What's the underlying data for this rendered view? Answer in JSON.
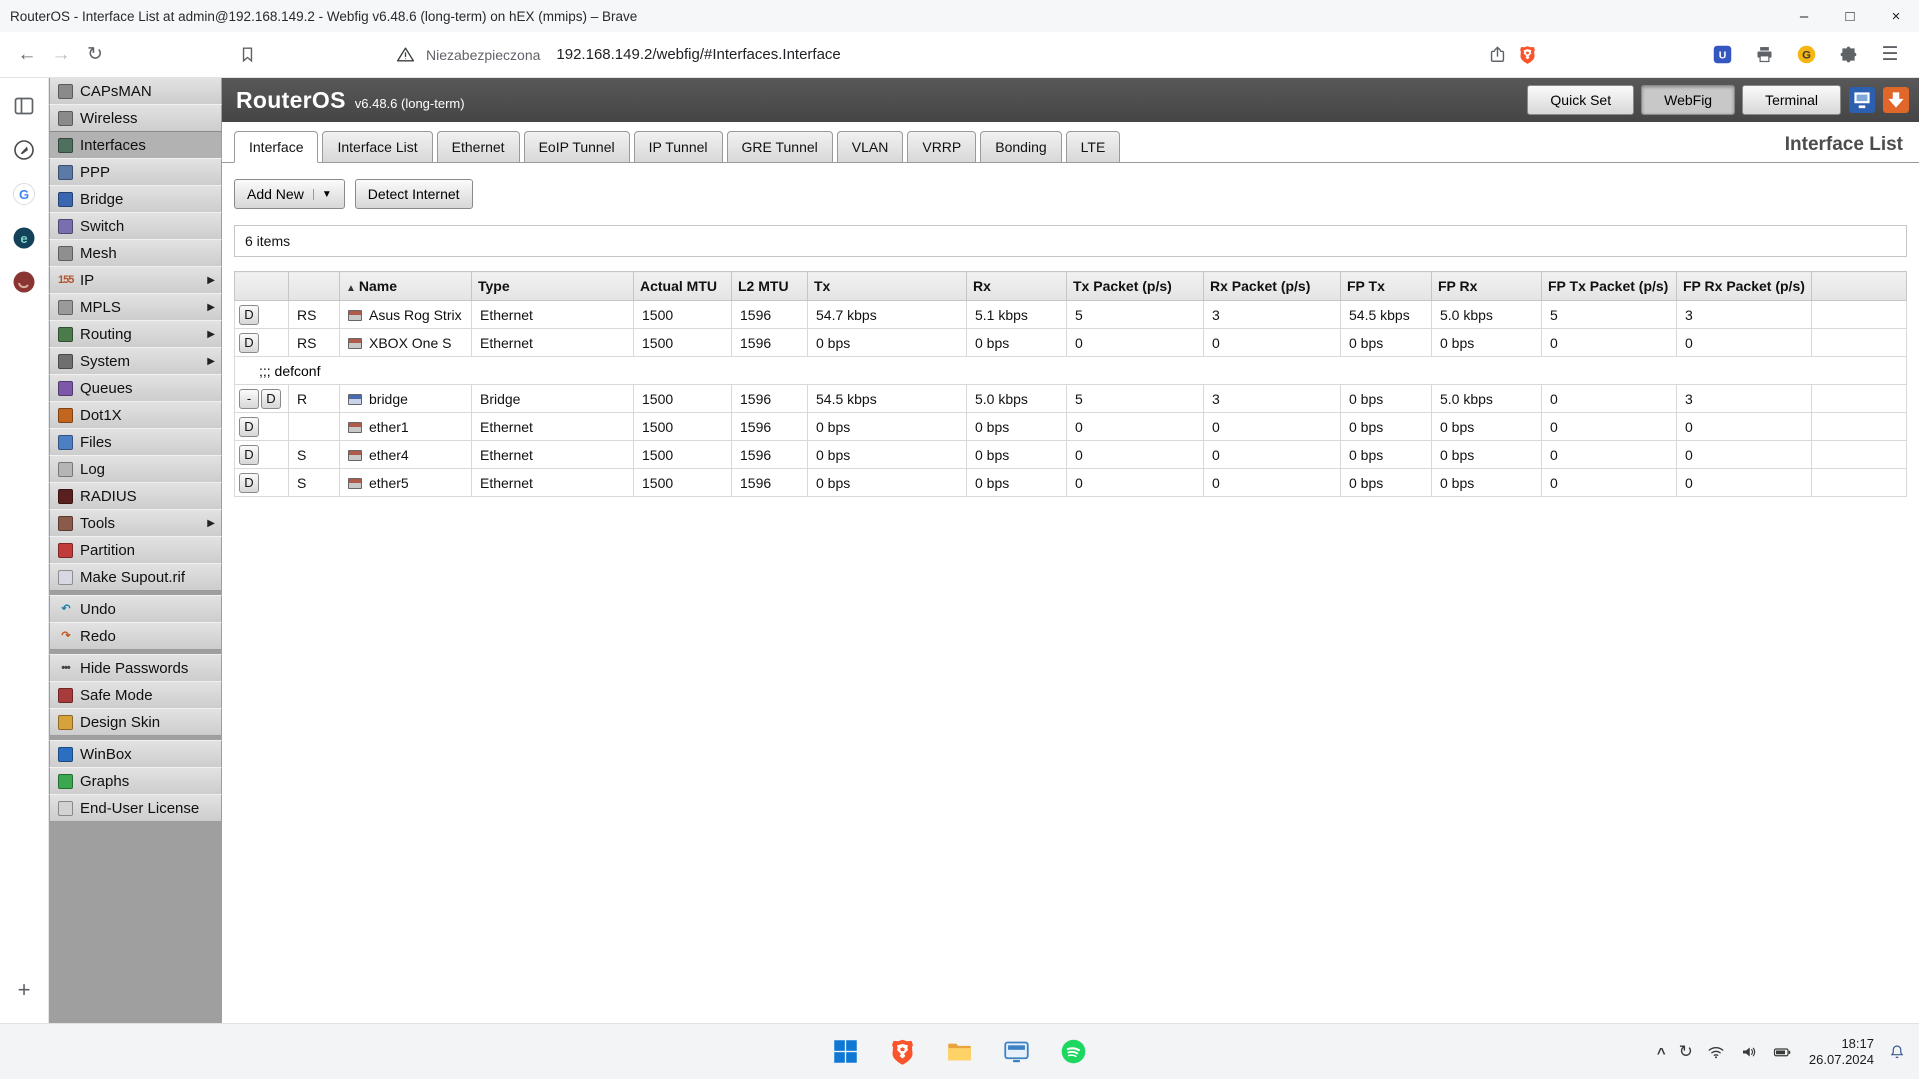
{
  "browser": {
    "window_title": "RouterOS - Interface List at admin@192.168.149.2 - Webfig v6.48.6 (long-term) on hEX (mmips) – Brave",
    "security_label": "Niezabezpieczona",
    "url": "192.168.149.2/webfig/#Interfaces.Interface"
  },
  "icons": {
    "back": "←",
    "forward": "→",
    "reload": "↻",
    "menu": "☰",
    "minimize": "–",
    "maximize": "□",
    "close": "×",
    "dropdown": "▼",
    "submenu": "▶",
    "sort_asc": "▲",
    "tray_chevron": "^",
    "tray_sync": "↻",
    "plus": "+",
    "ext_u": "U",
    "ext_g": "G",
    "google_g": "G",
    "edge_e": "e"
  },
  "routeros": {
    "brand": "RouterOS",
    "version": "v6.48.6 (long-term)",
    "header_buttons": [
      {
        "label": "Quick Set",
        "active": false
      },
      {
        "label": "WebFig",
        "active": true
      },
      {
        "label": "Terminal",
        "active": false
      }
    ],
    "page_title": "Interface List",
    "active_tab": "Interface",
    "tabs": [
      "Interface",
      "Interface List",
      "Ethernet",
      "EoIP Tunnel",
      "IP Tunnel",
      "GRE Tunnel",
      "VLAN",
      "VRRP",
      "Bonding",
      "LTE"
    ],
    "add_new_label": "Add New",
    "detect_internet_label": "Detect Internet",
    "items_count": "6 items"
  },
  "sidebar": {
    "items": [
      {
        "label": "CAPsMAN",
        "name": "capsman",
        "icon_bg": "#8a8a8a"
      },
      {
        "label": "Wireless",
        "name": "wireless",
        "icon_bg": "#8a8a8a"
      },
      {
        "label": "Interfaces",
        "name": "interfaces",
        "icon_bg": "#4f6f5f",
        "selected": true
      },
      {
        "label": "PPP",
        "name": "ppp",
        "icon_bg": "#5b7aa8"
      },
      {
        "label": "Bridge",
        "name": "bridge",
        "icon_bg": "#3b66b0"
      },
      {
        "label": "Switch",
        "name": "switch",
        "icon_bg": "#7a6fae"
      },
      {
        "label": "Mesh",
        "name": "mesh",
        "icon_bg": "#8f8f8f"
      },
      {
        "label": "IP",
        "name": "ip",
        "glyph": "155",
        "glyph_color": "#b3542e",
        "arrow": true
      },
      {
        "label": "MPLS",
        "name": "mpls",
        "icon_bg": "#9a9a9a",
        "arrow": true
      },
      {
        "label": "Routing",
        "name": "routing",
        "icon_bg": "#4b7a4b",
        "arrow": true
      },
      {
        "label": "System",
        "name": "system",
        "icon_bg": "#6f6f6f",
        "arrow": true
      },
      {
        "label": "Queues",
        "name": "queues",
        "icon_bg": "#7d58a8"
      },
      {
        "label": "Dot1X",
        "name": "dot1x",
        "icon_bg": "#c2661f"
      },
      {
        "label": "Files",
        "name": "files",
        "icon_bg": "#4d7fc4"
      },
      {
        "label": "Log",
        "name": "log",
        "icon_bg": "#b5b5b5"
      },
      {
        "label": "RADIUS",
        "name": "radius",
        "icon_bg": "#5a1f1f"
      },
      {
        "label": "Tools",
        "name": "tools",
        "icon_bg": "#8a5a4a",
        "arrow": true
      },
      {
        "label": "Partition",
        "name": "partition",
        "icon_bg": "#c23b3b"
      },
      {
        "label": "Make Supout.rif",
        "name": "make-supout-rif",
        "icon_bg": "#d8d8e2"
      },
      {
        "label": "Undo",
        "name": "undo",
        "glyph": "↶",
        "glyph_color": "#1f7fa8",
        "gap_before": true
      },
      {
        "label": "Redo",
        "name": "redo",
        "glyph": "↷",
        "glyph_color": "#c2551f"
      },
      {
        "label": "Hide Passwords",
        "name": "hide-passwords",
        "glyph": "•••",
        "glyph_color": "#444444",
        "gap_before": true
      },
      {
        "label": "Safe Mode",
        "name": "safe-mode",
        "icon_bg": "#a83b3b"
      },
      {
        "label": "Design Skin",
        "name": "design-skin",
        "icon_bg": "#d8a23b"
      },
      {
        "label": "WinBox",
        "name": "winbox",
        "icon_bg": "#2b6fc2",
        "gap_before": true
      },
      {
        "label": "Graphs",
        "name": "graphs",
        "icon_bg": "#3ba84f"
      },
      {
        "label": "End-User License",
        "name": "end-user-license",
        "icon_bg": "#d2d2d2"
      }
    ]
  },
  "table": {
    "sort_column": "Name",
    "headers": [
      "",
      "",
      "Name",
      "Type",
      "Actual MTU",
      "L2 MTU",
      "Tx",
      "Rx",
      "Tx Packet (p/s)",
      "Rx Packet (p/s)",
      "FP Tx",
      "FP Rx",
      "FP Tx Packet (p/s)",
      "FP Rx Packet (p/s)",
      ""
    ],
    "cell_keys": [
      "type",
      "actual-mtu",
      "l2-mtu",
      "tx",
      "rx",
      "tx-packet",
      "rx-packet",
      "fp-tx",
      "fp-rx",
      "fp-tx-packet",
      "fp-rx-packet"
    ],
    "rows": [
      {
        "kind": "data",
        "buttons": [
          "D"
        ],
        "flags": "RS",
        "icon": "ethernet",
        "name": "Asus Rog Strix",
        "cells": [
          "Ethernet",
          "1500",
          "1596",
          "54.7 kbps",
          "5.1 kbps",
          "5",
          "3",
          "54.5 kbps",
          "5.0 kbps",
          "5",
          "3"
        ]
      },
      {
        "kind": "data",
        "buttons": [
          "D"
        ],
        "flags": "RS",
        "icon": "ethernet",
        "name": "XBOX One S",
        "cells": [
          "Ethernet",
          "1500",
          "1596",
          "0 bps",
          "0 bps",
          "0",
          "0",
          "0 bps",
          "0 bps",
          "0",
          "0"
        ]
      },
      {
        "kind": "comment",
        "text": ";;; defconf"
      },
      {
        "kind": "data",
        "buttons": [
          "-",
          "D"
        ],
        "flags": "R",
        "icon": "bridge",
        "name": "bridge",
        "cells": [
          "Bridge",
          "1500",
          "1596",
          "54.5 kbps",
          "5.0 kbps",
          "5",
          "3",
          "0 bps",
          "5.0 kbps",
          "0",
          "3"
        ]
      },
      {
        "kind": "data",
        "buttons": [
          "D"
        ],
        "flags": "",
        "icon": "ethernet",
        "name": "ether1",
        "cells": [
          "Ethernet",
          "1500",
          "1596",
          "0 bps",
          "0 bps",
          "0",
          "0",
          "0 bps",
          "0 bps",
          "0",
          "0"
        ]
      },
      {
        "kind": "data",
        "buttons": [
          "D"
        ],
        "flags": "S",
        "icon": "ethernet",
        "name": "ether4",
        "cells": [
          "Ethernet",
          "1500",
          "1596",
          "0 bps",
          "0 bps",
          "0",
          "0",
          "0 bps",
          "0 bps",
          "0",
          "0"
        ]
      },
      {
        "kind": "data",
        "buttons": [
          "D"
        ],
        "flags": "S",
        "icon": "ethernet",
        "name": "ether5",
        "cells": [
          "Ethernet",
          "1500",
          "1596",
          "0 bps",
          "0 bps",
          "0",
          "0",
          "0 bps",
          "0 bps",
          "0",
          "0"
        ]
      }
    ]
  },
  "taskbar": {
    "time": "18:17",
    "date": "26.07.2024"
  }
}
